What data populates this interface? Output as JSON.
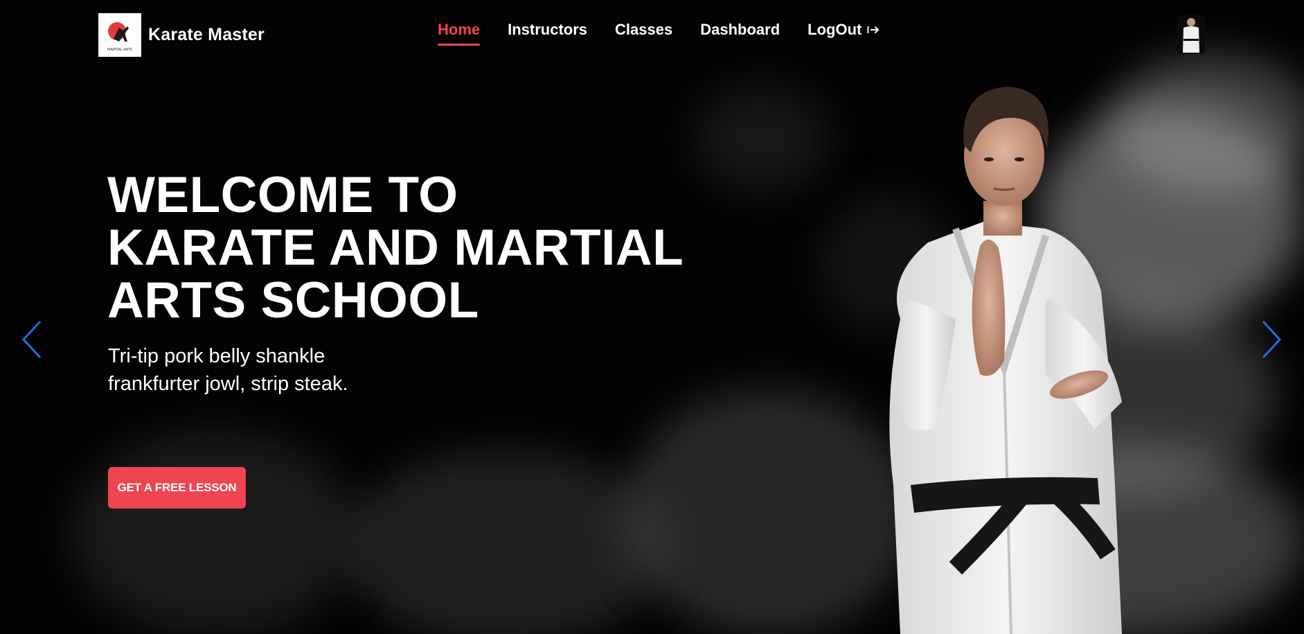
{
  "brand": {
    "name": "Karate Master",
    "logo_caption": "MARTIAL ARTS"
  },
  "nav": {
    "items": [
      {
        "label": "Home",
        "active": true
      },
      {
        "label": "Instructors",
        "active": false
      },
      {
        "label": "Classes",
        "active": false
      },
      {
        "label": "Dashboard",
        "active": false
      },
      {
        "label": "LogOut",
        "active": false,
        "icon": "logout-icon"
      }
    ]
  },
  "hero": {
    "title_lines": [
      "WELCOME TO",
      "KARATE AND MARTIAL",
      "ARTS SCHOOL"
    ],
    "subtitle_lines": [
      "Tri-tip pork belly shankle",
      "frankfurter jowl, strip steak."
    ],
    "cta_label": "GET A FREE LESSON"
  },
  "carousel": {
    "prev_icon": "chevron-left-icon",
    "next_icon": "chevron-right-icon"
  },
  "colors": {
    "accent": "#ef4452",
    "arrow": "#1e6fe0",
    "background": "#030303",
    "text": "#ffffff"
  }
}
